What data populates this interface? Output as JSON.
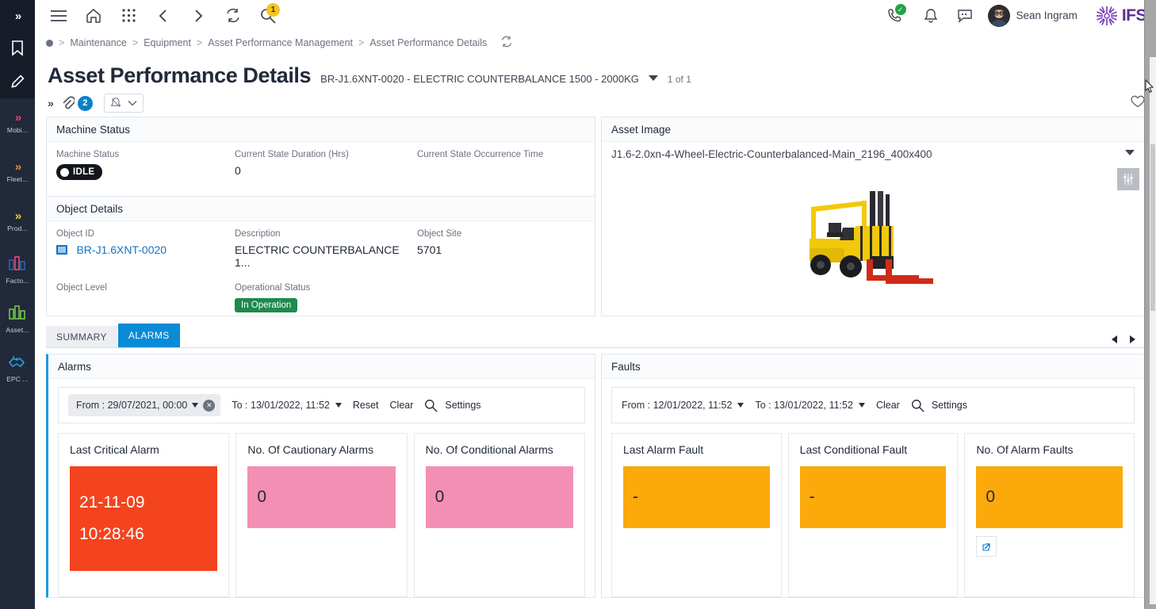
{
  "rail": {
    "expand_icon": "double-chevron-right-icon",
    "tools": [
      {
        "name": "bookmark-icon"
      },
      {
        "name": "pencil-icon"
      }
    ],
    "items": [
      {
        "icon": "double-chevron-right-icon",
        "label": "Mobi...",
        "color": "#e0486b"
      },
      {
        "icon": "double-chevron-right-icon",
        "label": "Fleet...",
        "color": "#f08b28"
      },
      {
        "icon": "double-chevron-right-icon",
        "label": "Prod...",
        "color": "#e2d33c"
      },
      {
        "icon": "bar-chart-icon",
        "label": "Facto...",
        "color": "#2f5fa8"
      },
      {
        "icon": "bar-chart-icon",
        "label": "Asset...",
        "color": "#6ebe4a"
      },
      {
        "icon": "handshake-icon",
        "label": "EPC ...",
        "color": "#2aa4d6"
      }
    ]
  },
  "topnav": {
    "menu_icon": "hamburger-menu-icon",
    "home_icon": "home-icon",
    "apps_icon": "grid-apps-icon",
    "back_icon": "chevron-left-icon",
    "forward_icon": "chevron-right-icon",
    "refresh_icon": "refresh-sync-icon",
    "search_icon": "search-icon",
    "search_badge": "1",
    "phone_icon": "phone-icon",
    "phone_status": "available-check",
    "bell_icon": "bell-icon",
    "chat_icon": "chat-bubble-icon",
    "avatar_name": "avatar",
    "user_name": "Sean Ingram",
    "brand": "IFS",
    "brand_color": "#5b2d90"
  },
  "breadcrumb": {
    "items": [
      "Maintenance",
      "Equipment",
      "Asset Performance Management",
      "Asset Performance Details"
    ],
    "separator": ">",
    "refresh_icon": "refresh-sync-icon"
  },
  "page": {
    "title": "Asset Performance Details",
    "subtitle": "BR-J1.6XNT-0020 - ELECTRIC COUNTERBALANCE 1500 - 2000KG",
    "record_count": "1 of 1",
    "caret_icon": "caret-down-icon"
  },
  "objbar": {
    "more_icon": "double-chevron-right-icon",
    "attachment_icon": "paperclip-icon",
    "attachment_count": "2",
    "notify_icon": "bell-outline-icon",
    "notify_caret_icon": "chevron-down-icon",
    "favorite_icon": "heart-outline-icon"
  },
  "machine_status": {
    "header": "Machine Status",
    "fields": [
      {
        "label": "Machine Status",
        "value": "IDLE",
        "type": "pill-dark"
      },
      {
        "label": "Current State Duration (Hrs)",
        "value": "0",
        "type": "text"
      },
      {
        "label": "Current State Occurrence Time",
        "value": "",
        "type": "text"
      }
    ]
  },
  "object_details": {
    "header": "Object Details",
    "row1": [
      {
        "label": "Object ID",
        "value": "BR-J1.6XNT-0020",
        "type": "link",
        "icon": "object-screen-icon"
      },
      {
        "label": "Description",
        "value": "ELECTRIC COUNTERBALANCE 1...",
        "type": "text"
      },
      {
        "label": "Object Site",
        "value": "5701",
        "type": "text"
      }
    ],
    "row2": [
      {
        "label": "Object Level",
        "value": "",
        "type": "text"
      },
      {
        "label": "Operational Status",
        "value": "In Operation",
        "type": "pill-green"
      }
    ]
  },
  "asset_image": {
    "header": "Asset Image",
    "filename": "J1.6-2.0xn-4-Wheel-Electric-Counterbalanced-Main_2196_400x400",
    "caret_icon": "caret-down-icon",
    "settings_icon": "sliders-icon",
    "image_alt": "yellow-forklift-image"
  },
  "tabs": {
    "items": [
      {
        "label": "SUMMARY",
        "active": false
      },
      {
        "label": "ALARMS",
        "active": true
      }
    ],
    "prev_icon": "triangle-left-icon",
    "next_icon": "triangle-right-icon"
  },
  "alarms_panel": {
    "header": "Alarms",
    "filter": {
      "from": "From : 29/07/2021, 00:00",
      "from_clear_icon": "x-circle-icon",
      "to": "To : 13/01/2022, 11:52",
      "reset": "Reset",
      "clear": "Clear",
      "search_icon": "search-icon",
      "settings": "Settings"
    },
    "kpis": [
      {
        "title": "Last Critical Alarm",
        "value_line1": "21-11-09",
        "value_line2": "10:28:46",
        "color": "red"
      },
      {
        "title": "No. Of Cautionary Alarms",
        "value_line1": "0",
        "color": "pink"
      },
      {
        "title": "No. Of Conditional Alarms",
        "value_line1": "0",
        "color": "pink"
      }
    ]
  },
  "faults_panel": {
    "header": "Faults",
    "filter": {
      "from": "From : 12/01/2022, 11:52",
      "to": "To : 13/01/2022, 11:52",
      "clear": "Clear",
      "search_icon": "search-icon",
      "settings": "Settings"
    },
    "kpis": [
      {
        "title": "Last Alarm Fault",
        "value_line1": "-",
        "color": "orange"
      },
      {
        "title": "Last Conditional Fault",
        "value_line1": "-",
        "color": "orange"
      },
      {
        "title": "No. Of Alarm Faults",
        "value_line1": "0",
        "color": "orange",
        "expand_icon": "external-link-icon"
      }
    ]
  },
  "colors": {
    "accent_blue": "#0a8bd6",
    "alarm_red": "#f4441f",
    "alarm_pink": "#f48fb4",
    "fault_orange": "#fba90b",
    "status_green": "#1d8a4e",
    "brand_purple": "#5b2d90"
  }
}
